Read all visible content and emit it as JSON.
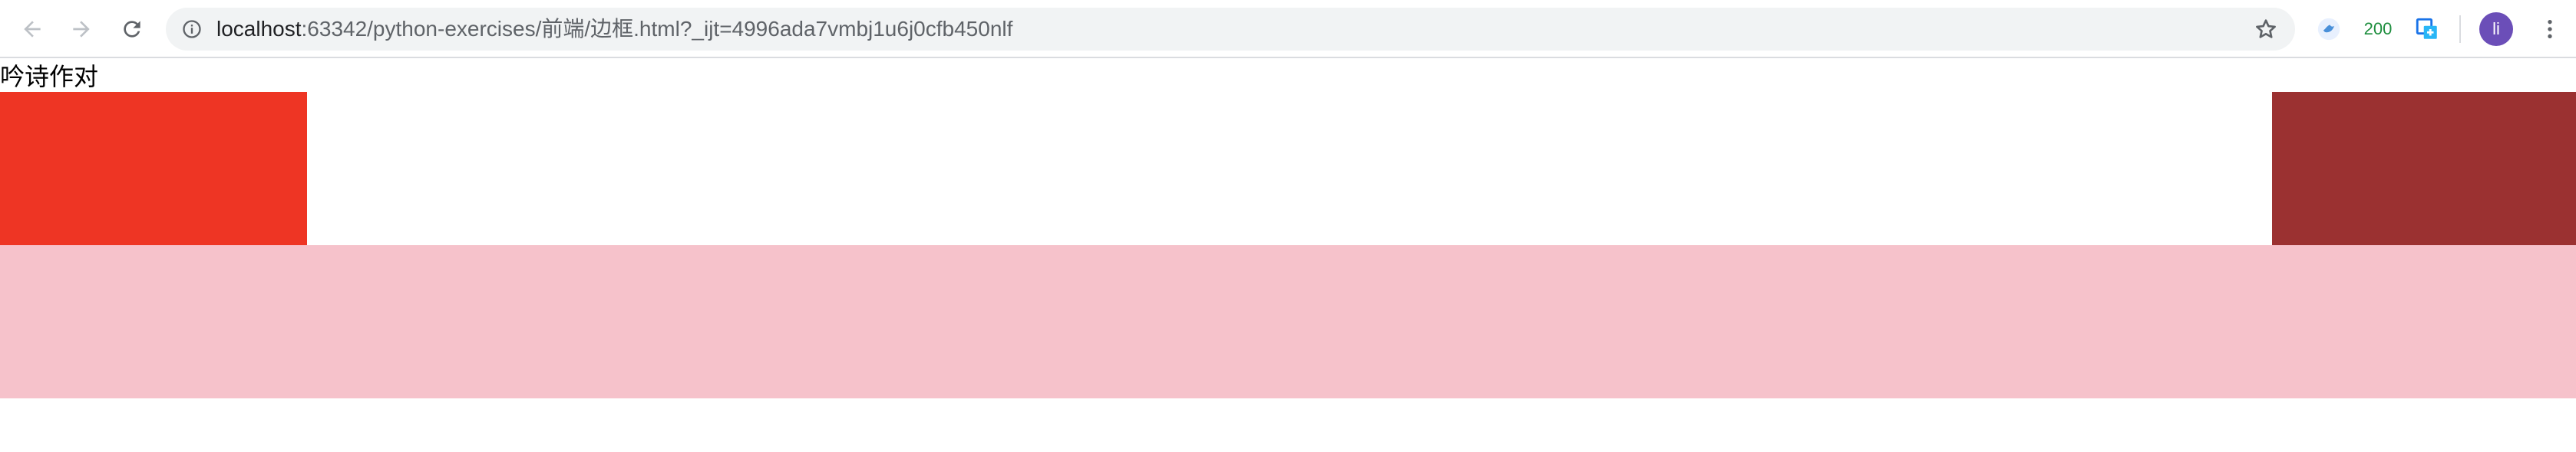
{
  "browser": {
    "url_host": "localhost",
    "url_rest": ":63342/python-exercises/前端/边框.html?_ijt=4996ada7vmbj1u6j0cfb450nlf",
    "extension_badge": "200",
    "profile_initial": "li",
    "icons": {
      "back": "arrow-left-icon",
      "forward": "arrow-right-icon",
      "reload": "reload-icon",
      "site_info": "info-icon",
      "bookmark": "star-icon",
      "menu": "more-vertical-icon"
    }
  },
  "page": {
    "heading": "吟诗作对",
    "colors": {
      "left_box": "#ee3524",
      "right_box": "#9b3131",
      "bottom_box": "#f6c2cb"
    }
  }
}
